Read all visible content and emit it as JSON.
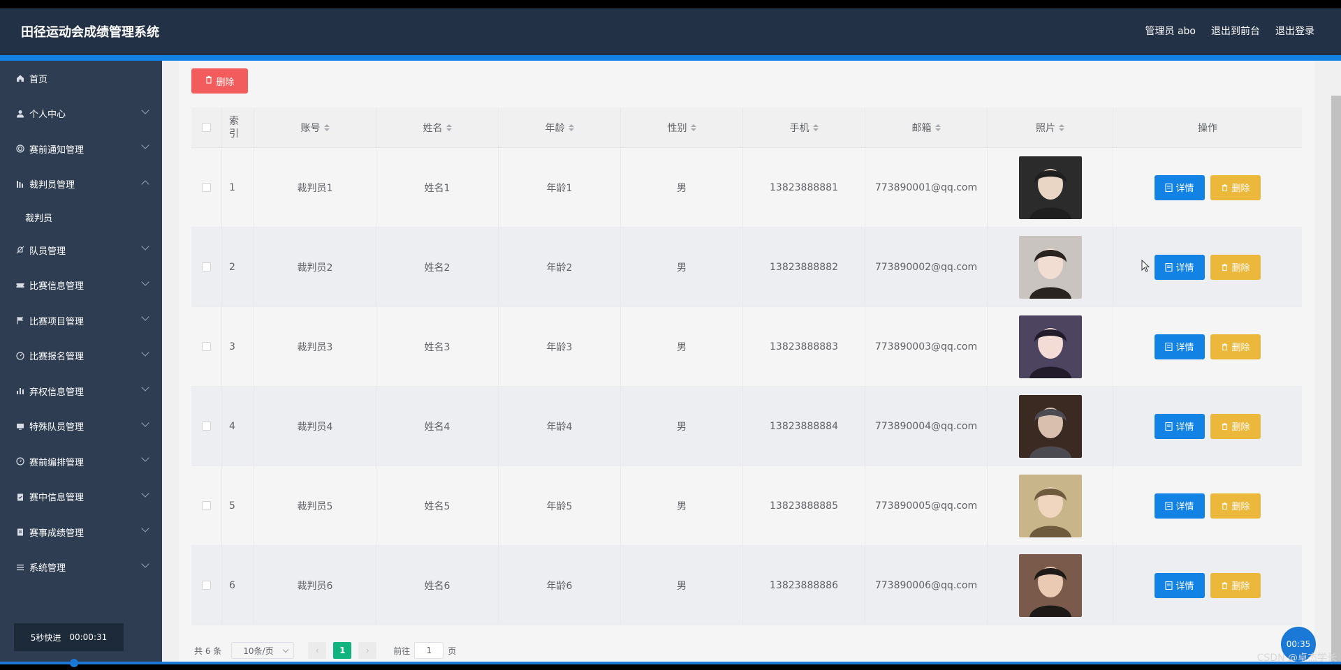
{
  "header": {
    "title": "田径运动会成绩管理系统",
    "user": "管理员 abo",
    "to_front": "退出到前台",
    "logout": "退出登录"
  },
  "sidebar": {
    "items": [
      {
        "label": "首页",
        "icon": "home-icon",
        "expandable": false
      },
      {
        "label": "个人中心",
        "icon": "user-icon",
        "expandable": true
      },
      {
        "label": "赛前通知管理",
        "icon": "circle-icon",
        "expandable": true
      },
      {
        "label": "裁判员管理",
        "icon": "bars-icon",
        "expandable": true,
        "expanded": true,
        "sub": [
          "裁判员"
        ]
      },
      {
        "label": "队员管理",
        "icon": "bell-off-icon",
        "expandable": true
      },
      {
        "label": "比赛信息管理",
        "icon": "ticket-icon",
        "expandable": true
      },
      {
        "label": "比赛项目管理",
        "icon": "flag-icon",
        "expandable": true
      },
      {
        "label": "比赛报名管理",
        "icon": "gauge-icon",
        "expandable": true
      },
      {
        "label": "弃权信息管理",
        "icon": "chart-icon",
        "expandable": true
      },
      {
        "label": "特殊队员管理",
        "icon": "monitor-icon",
        "expandable": true
      },
      {
        "label": "赛前编排管理",
        "icon": "compass-icon",
        "expandable": true
      },
      {
        "label": "赛中信息管理",
        "icon": "clipboard-check-icon",
        "expandable": true
      },
      {
        "label": "赛事成绩管理",
        "icon": "clipboard-icon",
        "expandable": true
      },
      {
        "label": "系统管理",
        "icon": "menu-icon",
        "expandable": true
      }
    ],
    "quick_label": "5秒快进",
    "quick_time": "00:00:31"
  },
  "toolbar": {
    "delete_label": "删除"
  },
  "table": {
    "headers": {
      "index": "索引",
      "account": "账号",
      "name": "姓名",
      "age": "年龄",
      "gender": "性别",
      "phone": "手机",
      "email": "邮箱",
      "photo": "照片",
      "op": "操作"
    },
    "detail_label": "详情",
    "delete_label": "删除",
    "rows": [
      {
        "index": "1",
        "account": "裁判员1",
        "name": "姓名1",
        "age": "年龄1",
        "gender": "男",
        "phone": "13823888881",
        "email": "773890001@qq.com"
      },
      {
        "index": "2",
        "account": "裁判员2",
        "name": "姓名2",
        "age": "年龄2",
        "gender": "男",
        "phone": "13823888882",
        "email": "773890002@qq.com"
      },
      {
        "index": "3",
        "account": "裁判员3",
        "name": "姓名3",
        "age": "年龄3",
        "gender": "男",
        "phone": "13823888883",
        "email": "773890003@qq.com"
      },
      {
        "index": "4",
        "account": "裁判员4",
        "name": "姓名4",
        "age": "年龄4",
        "gender": "男",
        "phone": "13823888884",
        "email": "773890004@qq.com"
      },
      {
        "index": "5",
        "account": "裁判员5",
        "name": "姓名5",
        "age": "年龄5",
        "gender": "男",
        "phone": "13823888885",
        "email": "773890005@qq.com"
      },
      {
        "index": "6",
        "account": "裁判员6",
        "name": "姓名6",
        "age": "年龄6",
        "gender": "男",
        "phone": "13823888886",
        "email": "773890006@qq.com"
      }
    ]
  },
  "pagination": {
    "total": "共 6 条",
    "page_size": "10条/页",
    "current_page": "1",
    "goto_label": "前往",
    "goto_value": "1",
    "page_suffix": "页"
  },
  "overlay": {
    "timer": "00:35",
    "watermark": "CSDN @卓杰学长"
  },
  "colors": {
    "header_bg": "#233146",
    "sidebar_bg": "#2e3d51",
    "accent": "#1282e4",
    "danger": "#f35c5c",
    "warning": "#ebb83b",
    "page_active": "#11b37e"
  }
}
